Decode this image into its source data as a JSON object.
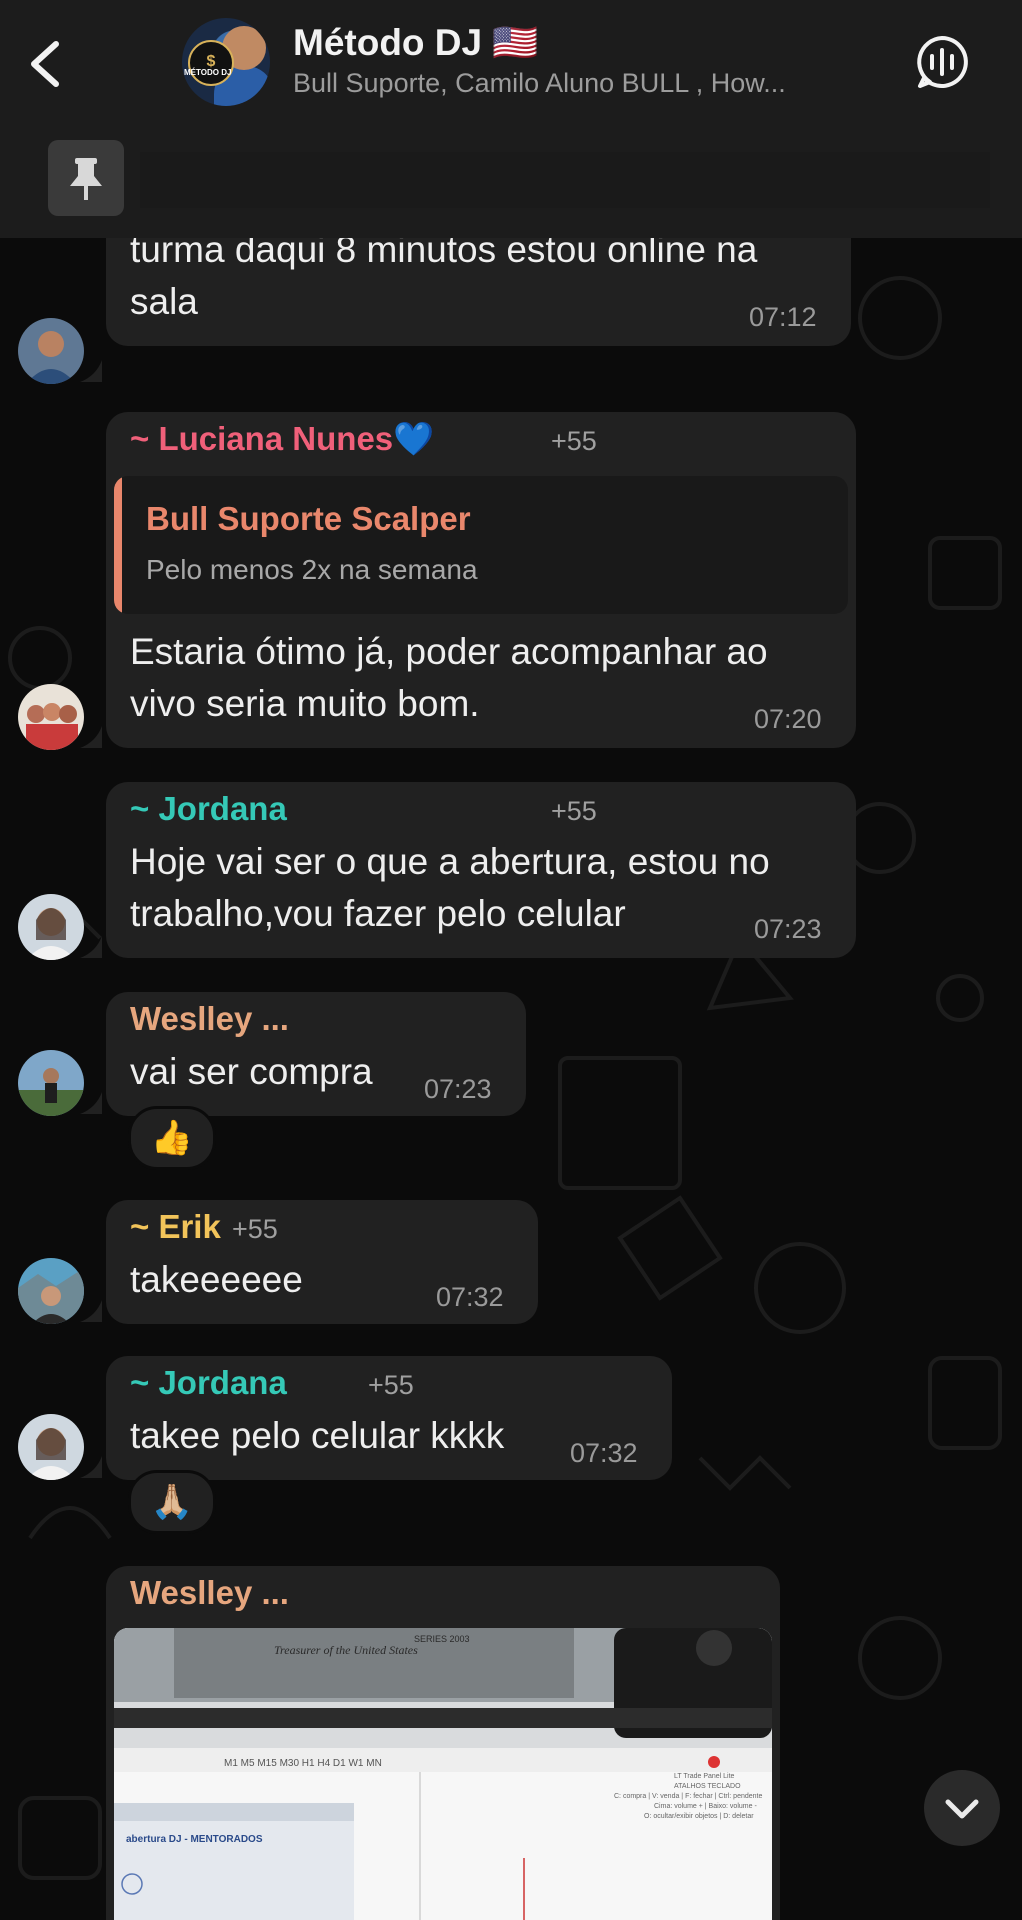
{
  "header": {
    "title": "Método DJ 🇺🇸",
    "subtitle": "Bull Suporte, Camilo Aluno BULL , How...",
    "avatar_logo_text": "MÉTODO DJ",
    "avatar_logo_symbol": "$"
  },
  "messages": [
    {
      "text_line1": "turma daqui 8 minutos estou online na",
      "text_line2": "sala",
      "time": "07:12"
    },
    {
      "sender": "~ Luciana Nunes💙",
      "phone": "+55",
      "quote_sender": "Bull Suporte Scalper",
      "quote_text": "Pelo menos 2x na semana",
      "text_line1": "Estaria ótimo já, poder acompanhar ao",
      "text_line2": "vivo seria muito bom.",
      "time": "07:20"
    },
    {
      "sender": "~ Jordana",
      "phone": "+55",
      "text_line1": "Hoje vai ser o que a abertura, estou no",
      "text_line2": "trabalho,vou fazer pelo celular",
      "time": "07:23"
    },
    {
      "sender": "Weslley ...",
      "text_line1": "vai ser compra",
      "time": "07:23",
      "reaction": "👍"
    },
    {
      "sender": "~ Erik",
      "phone": "+55",
      "text_line1": "takeeeeee",
      "time": "07:32"
    },
    {
      "sender": "~ Jordana",
      "phone": "+55",
      "text_line1": "takee pelo celular kkkk",
      "time": "07:32",
      "reaction": "🙏🏼"
    },
    {
      "sender": "Weslley ..."
    }
  ],
  "photo_text": {
    "bill_text": "Treasurer of the United States",
    "bill_series": "SERIES 2003",
    "toolbar_items": "M1  M5  M15  M30  H1  H4  D1  W1  MN",
    "window_title": "abertura DJ - MENTORADOS",
    "panel_lines": [
      "LT Trade Panel Lite",
      "ATALHOS TECLADO",
      "C: compra | V: venda | F: fechar | Ctrl: pendente",
      "Cima: volume + | Baixo: volume -",
      "O: ocultar/exibir objetos | D: deletar"
    ]
  },
  "colors": {
    "luciana": "#f0607a",
    "jordana": "#35c9b7",
    "weslley": "#e6a67e",
    "erik": "#f2c45a",
    "quote_accent": "#e9876c"
  }
}
